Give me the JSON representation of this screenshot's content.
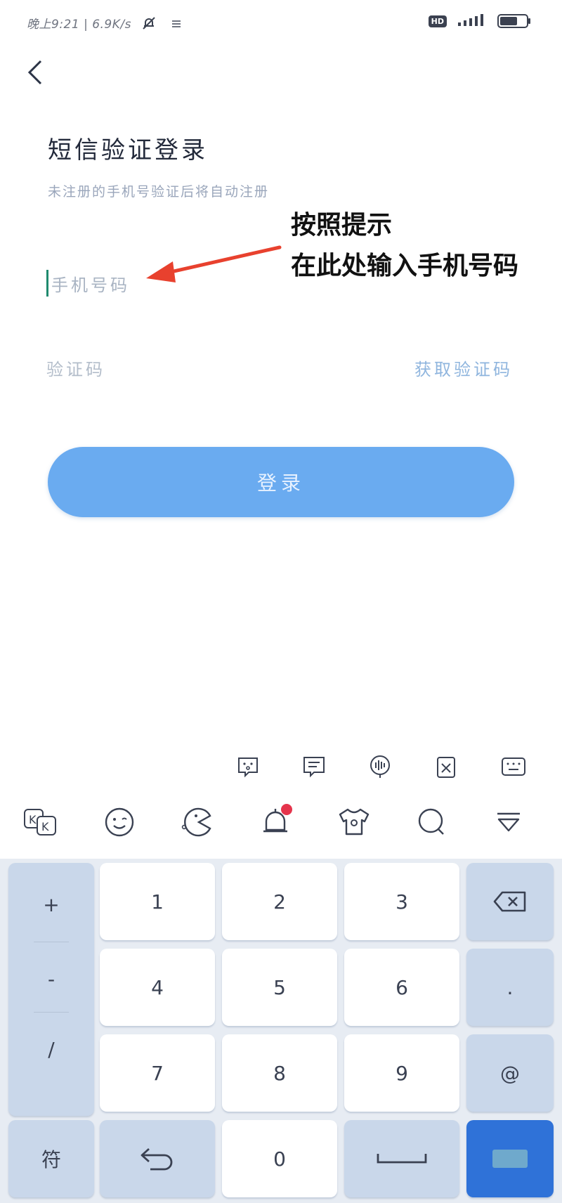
{
  "status_bar": {
    "time_text": "晚上9:21 | 6.9K/s",
    "hd_label": "HD",
    "icons": [
      "muted-bell-icon",
      "menu-icon",
      "hd-icon",
      "signal-icon",
      "battery-icon"
    ]
  },
  "header": {
    "back_icon": "chevron-left-icon"
  },
  "login": {
    "title": "短信验证登录",
    "subtitle": "未注册的手机号验证后将自动注册",
    "phone_placeholder": "手机号码",
    "code_placeholder": "验证码",
    "get_code_label": "获取验证码",
    "login_button_label": "登录"
  },
  "annotation": {
    "line1": "按照提示",
    "line2": "在此处输入手机号码",
    "arrow_color": "#e8412e"
  },
  "keyboard": {
    "top_icons": [
      "emoji-face-icon",
      "text-list-icon",
      "voice-icon",
      "clipboard-icon",
      "keyboard-icon"
    ],
    "toolbar_icons": [
      "kk-icon",
      "smile-icon",
      "pacman-emoji-icon",
      "bell-notification-icon",
      "tshirt-icon",
      "search-icon",
      "collapse-icon"
    ],
    "side_keys": [
      "+",
      "-",
      "/"
    ],
    "symbol_key": "符",
    "digit_rows": [
      [
        "1",
        "2",
        "3"
      ],
      [
        "4",
        "5",
        "6"
      ],
      [
        "7",
        "8",
        "9"
      ]
    ],
    "zero_key": "0",
    "dot_key": ".",
    "at_key": "@",
    "colors": {
      "accent": "#2f72d8",
      "key_side": "#c9d7ea",
      "login_button": "#6aabf0"
    }
  }
}
